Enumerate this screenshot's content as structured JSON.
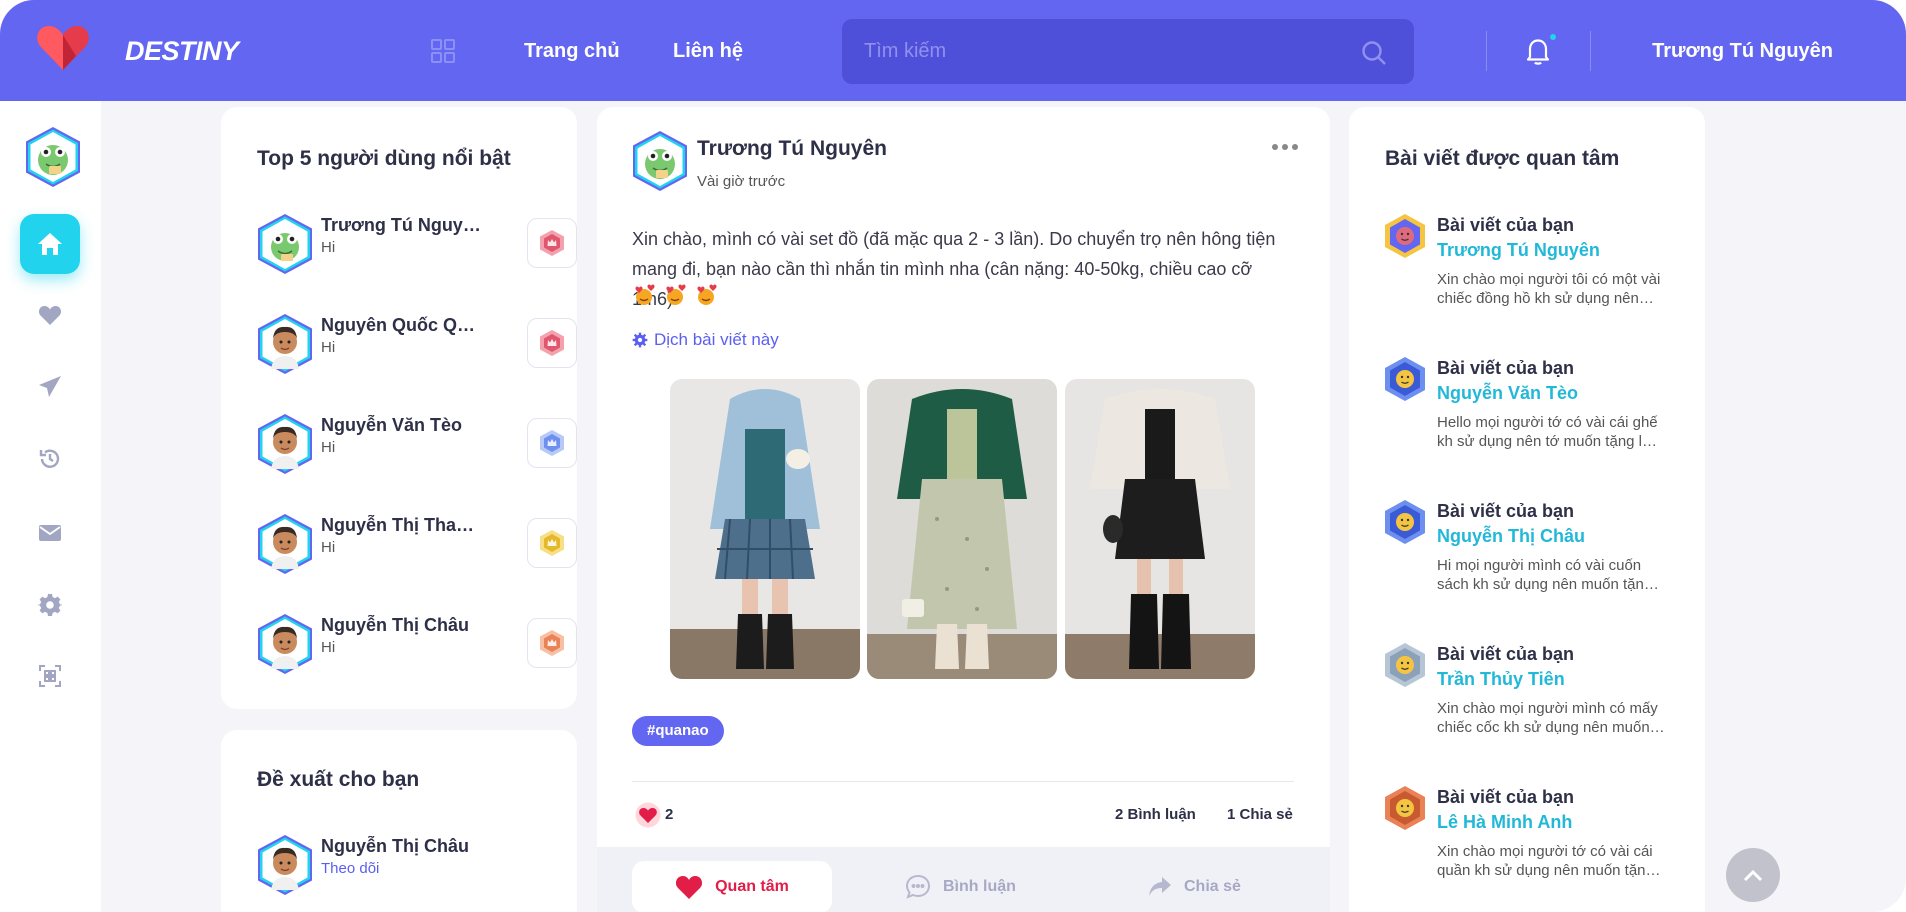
{
  "header": {
    "brand": "DESTINY",
    "nav": [
      {
        "label": "Trang chủ"
      },
      {
        "label": "Liên hệ"
      }
    ],
    "search_placeholder": "Tìm kiếm",
    "user_name": "Trương Tú Nguyên"
  },
  "colors": {
    "primary": "#6366f1",
    "accent_cyan": "#22d3ee",
    "like_red": "#e11d48"
  },
  "rail": {
    "icons": [
      "home-icon",
      "heart-icon",
      "send-icon",
      "history-icon",
      "mail-icon",
      "gear-icon",
      "scan-icon"
    ]
  },
  "top_users": {
    "title": "Top 5 người dùng nổi bật",
    "items": [
      {
        "name": "Trương Tú Nguyên",
        "status": "Hi",
        "badge": "rank-1-red"
      },
      {
        "name": "Nguyên Quốc Quân",
        "status": "Hi",
        "badge": "rank-2-red"
      },
      {
        "name": "Nguyễn Văn Tèo",
        "status": "Hi",
        "badge": "rank-3-blue"
      },
      {
        "name": "Nguyễn Thị Thanh Hằng",
        "status": "Hi",
        "badge": "rank-4-gold"
      },
      {
        "name": "Nguyễn Thị Châu",
        "status": "Hi",
        "badge": "rank-5-orange"
      }
    ]
  },
  "suggest": {
    "title": "Đề xuất cho bạn",
    "items": [
      {
        "name": "Nguyễn Thị Châu",
        "action": "Theo dõi"
      }
    ]
  },
  "post": {
    "author": "Trương Tú Nguyên",
    "time": "Vài giờ trước",
    "text": "Xin chào, mình có vài set đồ (đã mặc qua 2 - 3 lần). Do chuyển trọ nên hông tiện mang đi, bạn nào cần thì nhắn tin mình nha (cân nặng: 40-50kg, chiều cao cỡ 1m6)",
    "translate": "Dịch bài viết này",
    "hashtag": "#quanao",
    "likes": "2",
    "comments": "2 Bình luận",
    "shares": "1 Chia sẻ",
    "actions": {
      "like": "Quan tâm",
      "comment": "Bình luận",
      "share": "Chia sẻ"
    }
  },
  "trending": {
    "title": "Bài viết được quan tâm",
    "items": [
      {
        "label": "Bài viết của bạn",
        "name": "Trương Tú Nguyên",
        "desc": "Xin chào mọi người tôi có một vài chiếc đồng hồ kh sử dụng nên muốn tặng lại cho ai cần"
      },
      {
        "label": "Bài viết của bạn",
        "name": "Nguyễn Văn Tèo",
        "desc": "Hello mọi người tớ có vài cái ghế kh sử dụng nên tớ muốn tặng lại cho bạn nào cần"
      },
      {
        "label": "Bài viết của bạn",
        "name": "Nguyễn Thị Châu",
        "desc": "Hi mọi người mình có vài cuốn sách kh sử dụng nên muốn tặng lại cho bạn nào cần"
      },
      {
        "label": "Bài viết của bạn",
        "name": "Trần Thủy Tiên",
        "desc": "Xin chào mọi người mình có mấy chiếc cốc kh sử dụng nên muốn tặng lại"
      },
      {
        "label": "Bài viết của bạn",
        "name": "Lê Hà Minh Anh",
        "desc": "Xin chào mọi người tớ có vài cái quần kh sử dụng nên muốn tặng lại cho ai cần"
      }
    ]
  }
}
